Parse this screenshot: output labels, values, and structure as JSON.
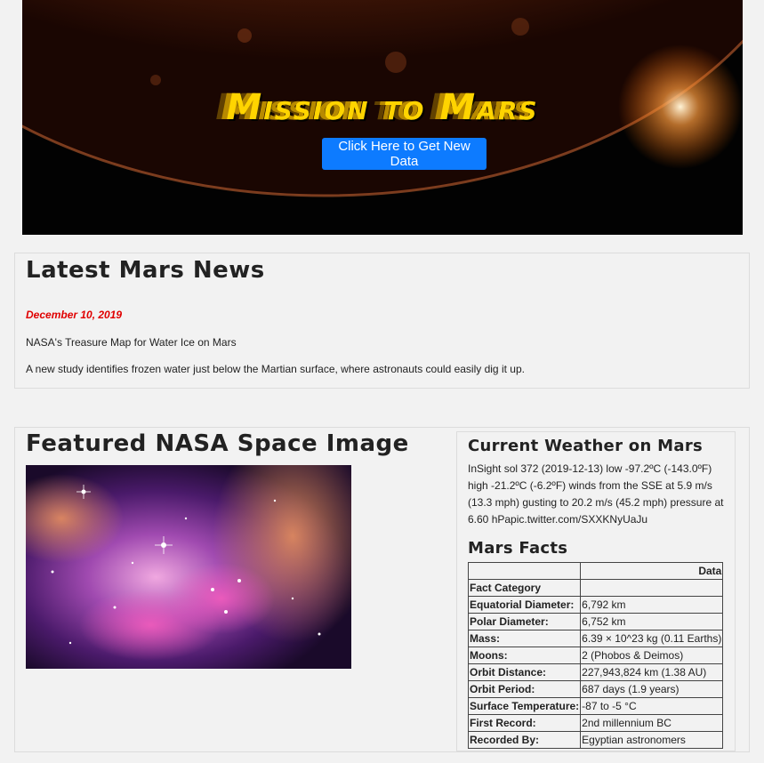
{
  "hero": {
    "title": "Mission to Mars",
    "button_label": "Click Here to Get New Data"
  },
  "news": {
    "heading": "Latest Mars News",
    "date": "December 10, 2019",
    "title": "NASA's Treasure Map for Water Ice on Mars",
    "body": "A new study identifies frozen water just below the Martian surface, where astronauts could easily dig it up."
  },
  "featured": {
    "heading": "Featured NASA Space Image"
  },
  "weather": {
    "heading": "Current Weather on Mars",
    "text": "InSight sol 372 (2019-12-13) low -97.2ºC (-143.0ºF) high -21.2ºC (-6.2ºF) winds from the SSE at 5.9 m/s (13.3 mph) gusting to 20.2 m/s (45.2 mph) pressure at 6.60 hPapic.twitter.com/SXXKNyUaJu"
  },
  "facts": {
    "heading": "Mars Facts",
    "column_header": "Data",
    "index_label": "Fact Category",
    "rows": [
      {
        "label": "Equatorial Diameter:",
        "value": "6,792 km"
      },
      {
        "label": "Polar Diameter:",
        "value": "6,752 km"
      },
      {
        "label": "Mass:",
        "value": "6.39 × 10^23 kg (0.11 Earths)"
      },
      {
        "label": "Moons:",
        "value": "2 (Phobos & Deimos)"
      },
      {
        "label": "Orbit Distance:",
        "value": "227,943,824 km (1.38 AU)"
      },
      {
        "label": "Orbit Period:",
        "value": "687 days (1.9 years)"
      },
      {
        "label": "Surface Temperature:",
        "value": "-87 to -5 °C"
      },
      {
        "label": "First Record:",
        "value": "2nd millennium BC"
      },
      {
        "label": "Recorded By:",
        "value": "Egyptian astronomers"
      }
    ]
  },
  "colors": {
    "accent": "#0d7bff",
    "date_red": "#e00000",
    "title_yellow": "#ffd400"
  }
}
